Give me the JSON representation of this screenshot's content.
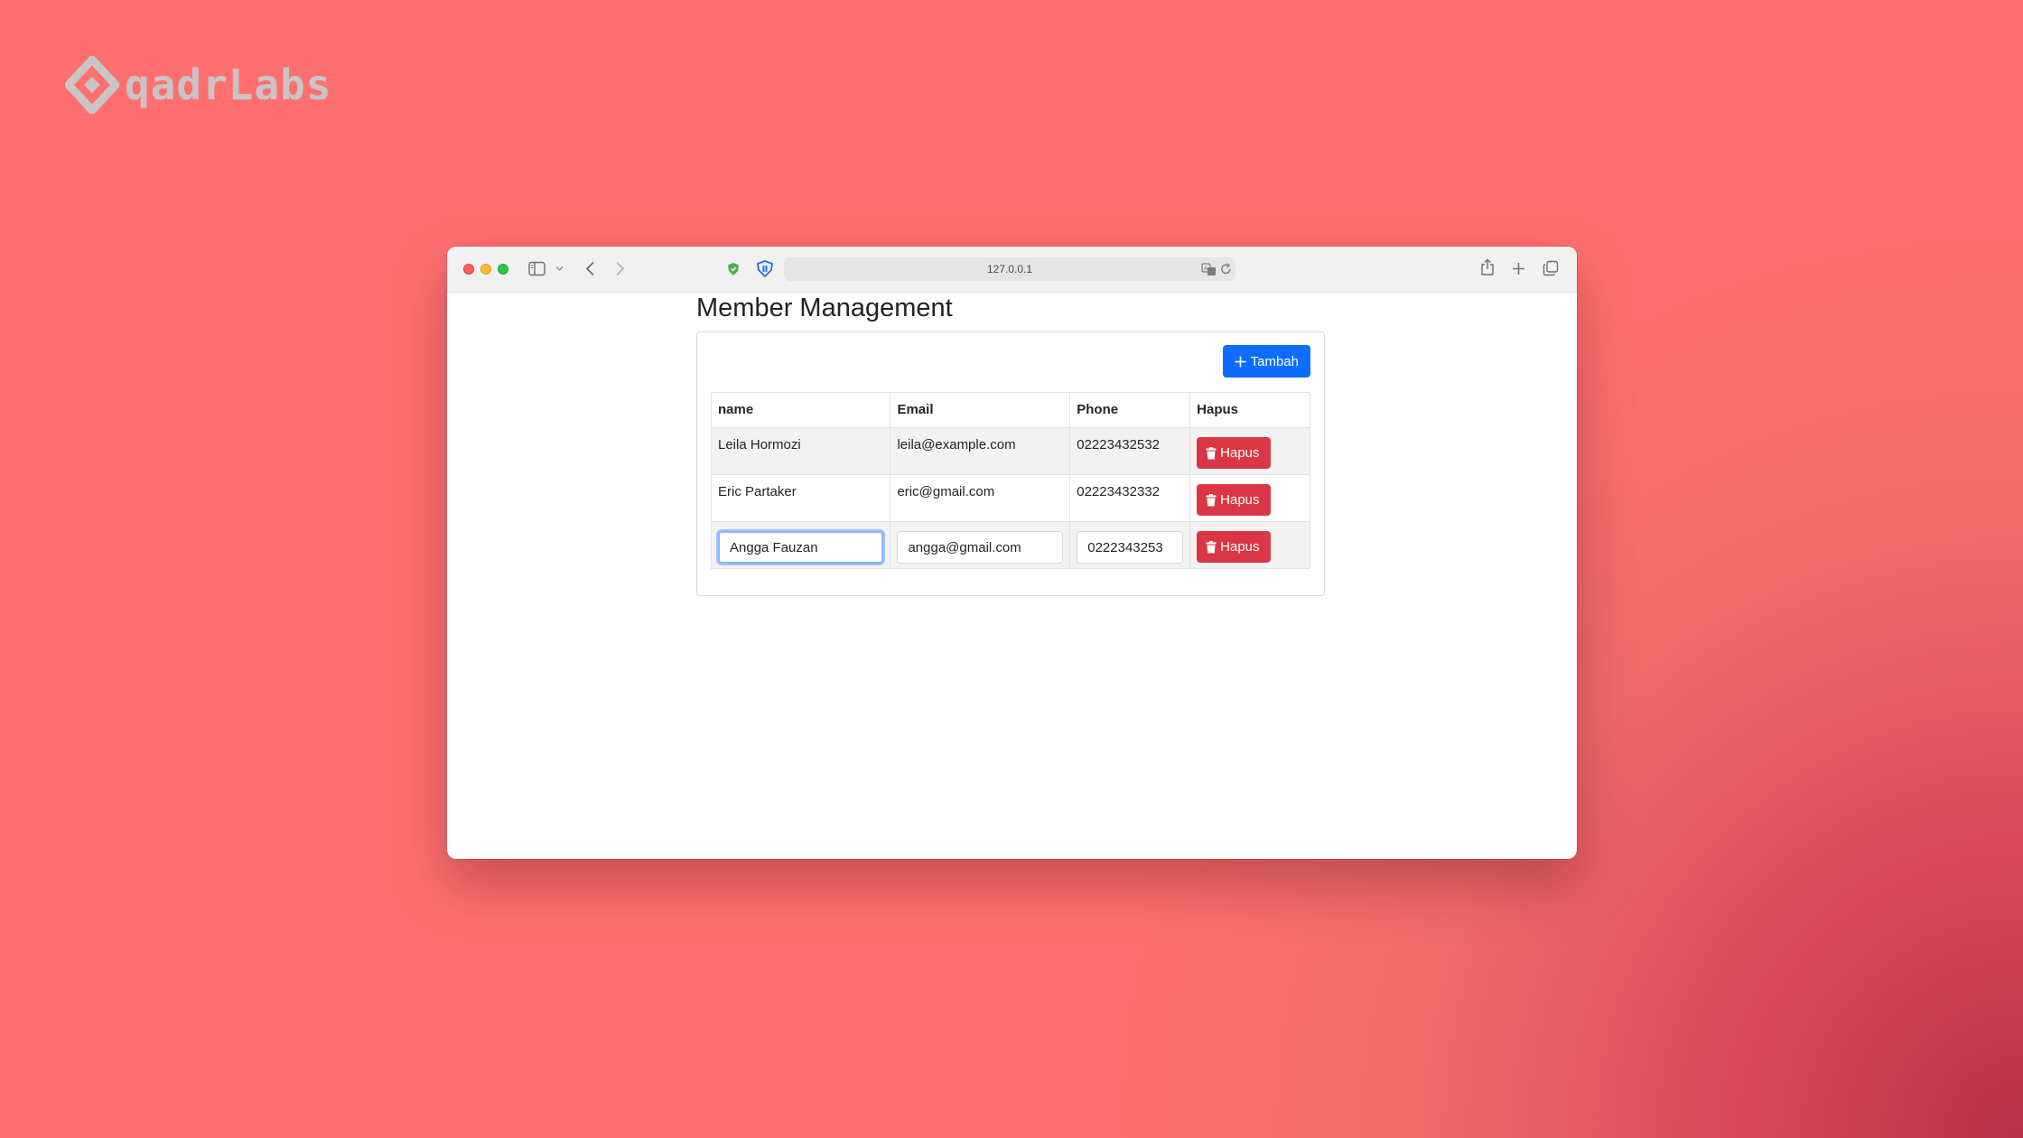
{
  "brand": {
    "name": "qadrLabs",
    "icon": "diamond-logo-icon"
  },
  "browser": {
    "url": "127.0.0.1",
    "icons": [
      "sidebar-icon",
      "chevron-down-icon",
      "back-arrow-icon",
      "forward-arrow-icon",
      "shield-icon",
      "password-manager-icon",
      "translate-icon",
      "reload-icon",
      "share-icon",
      "new-tab-icon",
      "tab-overview-icon"
    ]
  },
  "page": {
    "title": "Member Management",
    "add_button": {
      "label": "Tambah",
      "icon": "plus-icon",
      "color": "#0d6efd"
    },
    "table": {
      "headers": [
        "name",
        "Email",
        "Phone",
        "Hapus"
      ],
      "rows": [
        {
          "name": "Leila Hormozi",
          "email": "leila@example.com",
          "phone": "02223432532",
          "delete_label": "Hapus"
        },
        {
          "name": "Eric Partaker",
          "email": "eric@gmail.com",
          "phone": "02223432332",
          "delete_label": "Hapus"
        }
      ],
      "edit_row": {
        "name": "Angga Fauzan",
        "email": "angga@gmail.com",
        "phone": "0222343253",
        "delete_label": "Hapus"
      },
      "delete_color": "#dc3545",
      "delete_icon": "trash-icon"
    }
  },
  "colors": {
    "background": "#ff6f6f",
    "primary": "#0d6efd",
    "danger": "#dc3545"
  }
}
